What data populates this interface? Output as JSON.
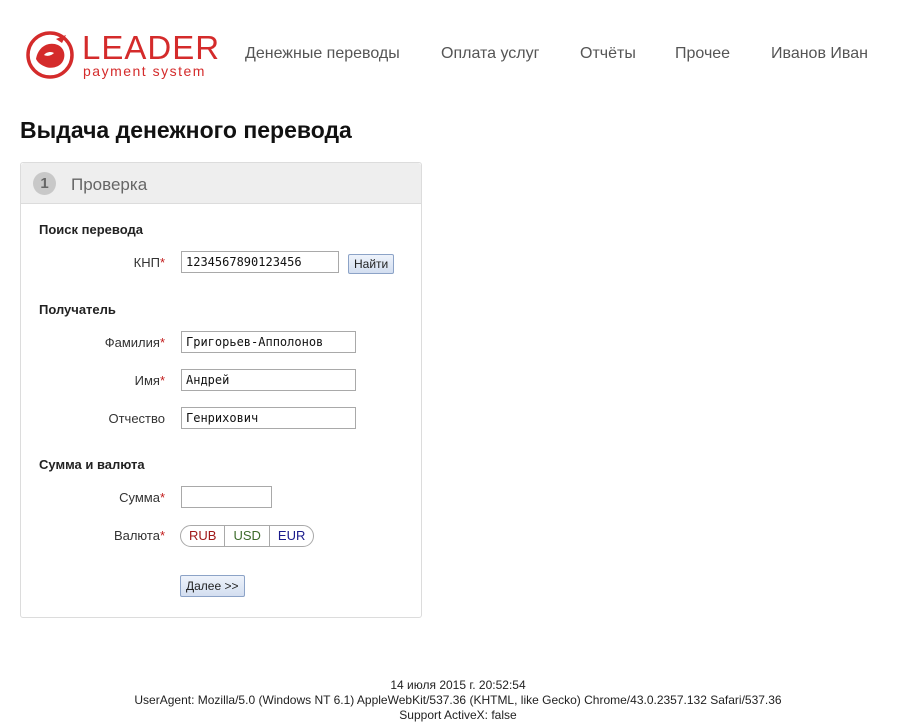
{
  "logo": {
    "title": "LEADER",
    "subtitle": "payment system",
    "brand_color": "#d42b2b"
  },
  "nav": {
    "items": [
      "Денежные переводы",
      "Оплата услуг",
      "Отчёты",
      "Прочее"
    ],
    "user": "Иванов Иван"
  },
  "page_title": "Выдача денежного перевода",
  "panel": {
    "step_number": "1",
    "step_title": "Проверка"
  },
  "search": {
    "section_title": "Поиск перевода",
    "knp_label": "КНП",
    "knp_value": "1234567890123456",
    "find_button": "Найти"
  },
  "recipient": {
    "section_title": "Получатель",
    "lastname_label": "Фамилия",
    "lastname_value": "Григорьев-Апполонов",
    "firstname_label": "Имя",
    "firstname_value": "Андрей",
    "patronymic_label": "Отчество",
    "patronymic_value": "Генрихович"
  },
  "amount": {
    "section_title": "Сумма и валюта",
    "amount_label": "Сумма",
    "amount_value": "",
    "currency_label": "Валюта",
    "currencies": [
      "RUB",
      "USD",
      "EUR"
    ],
    "next_button": "Далее >>"
  },
  "required_mark": "*",
  "footer": {
    "datetime": "14 июля 2015 г. 20:52:54",
    "useragent": "UserAgent: Mozilla/5.0 (Windows NT 6.1) AppleWebKit/537.36 (KHTML, like Gecko) Chrome/43.0.2357.132 Safari/537.36",
    "activex": "Support ActiveX: false"
  }
}
